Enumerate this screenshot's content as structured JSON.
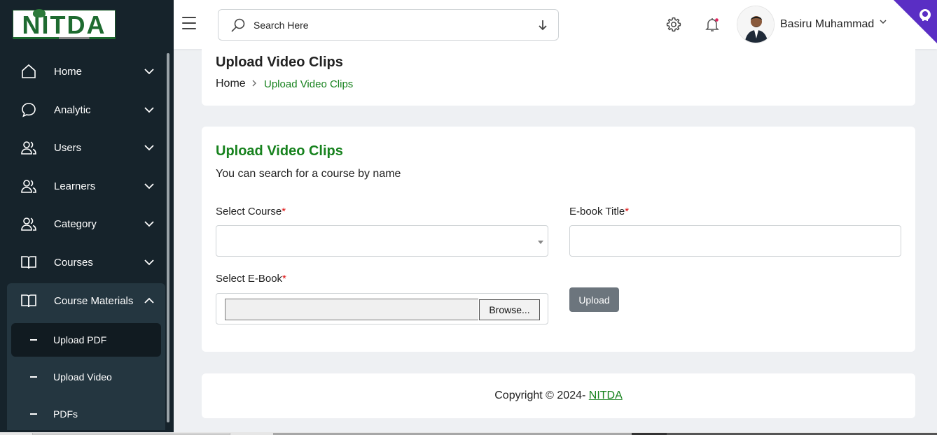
{
  "brand": {
    "logo_text": "NITDA"
  },
  "sidebar": {
    "items": [
      {
        "label": "Home",
        "icon": "home-icon"
      },
      {
        "label": "Analytic",
        "icon": "chat-bubble-icon"
      },
      {
        "label": "Users",
        "icon": "users-icon"
      },
      {
        "label": "Learners",
        "icon": "users-icon"
      },
      {
        "label": "Category",
        "icon": "users-icon"
      },
      {
        "label": "Courses",
        "icon": "book-icon"
      },
      {
        "label": "Course Materials",
        "icon": "book-icon",
        "expanded": true
      }
    ],
    "submenu": [
      {
        "label": "Upload PDF",
        "active": true
      },
      {
        "label": "Upload Video"
      },
      {
        "label": "PDFs"
      }
    ]
  },
  "header": {
    "search_placeholder": "Search Here",
    "user_name": "Basiru Muhammad"
  },
  "page": {
    "title": "Upload Video Clips",
    "breadcrumb": {
      "home": "Home",
      "current": "Upload Video Clips"
    }
  },
  "form": {
    "title": "Upload Video Clips",
    "subtitle": "You can search for a course by name",
    "course_label": "Select Course",
    "course_value": "",
    "ebook_title_label": "E-book Title",
    "ebook_title_value": "",
    "file_label": "Select E-Book",
    "browse_label": "Browse...",
    "upload_label": "Upload",
    "required_mark": "*"
  },
  "footer": {
    "copyright_prefix": "Copyright © 2024- ",
    "copyright_link": "NITDA"
  },
  "colors": {
    "sidebar_bg": "#16232b",
    "accent_green": "#17821e",
    "required_red": "#dd1111",
    "button_gray": "#6c757d",
    "corner_purple": "#5a2ec4"
  }
}
